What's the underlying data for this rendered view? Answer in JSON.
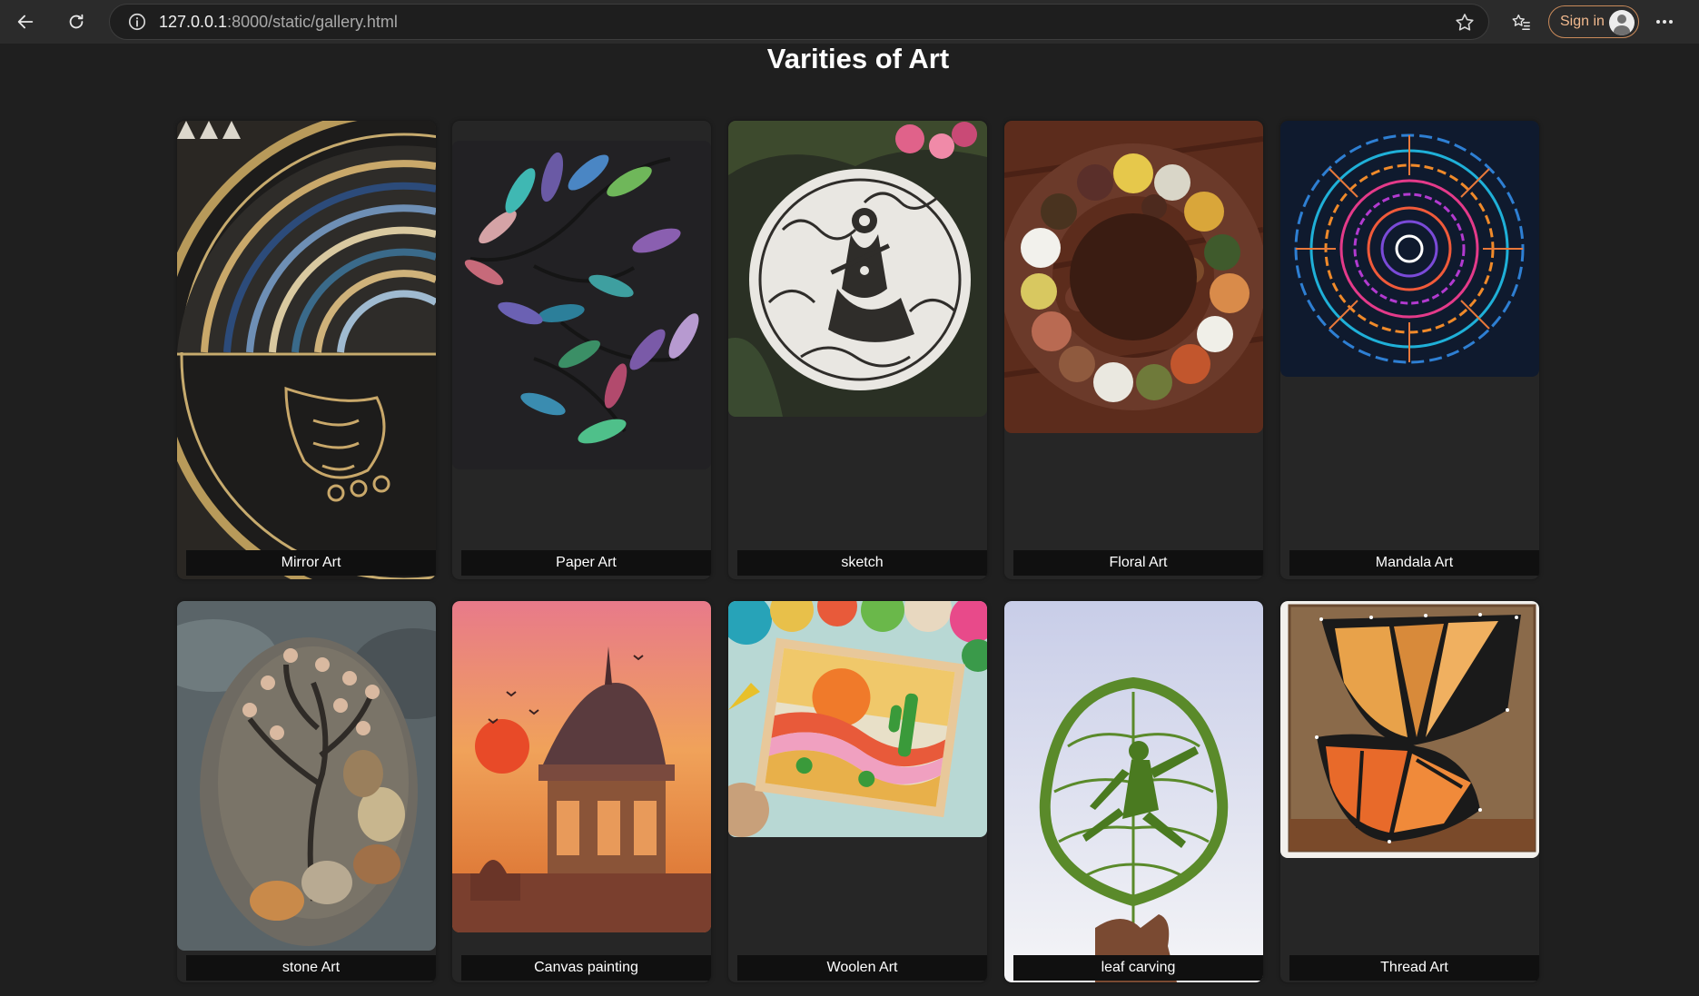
{
  "browser": {
    "url_host": "127.0.0.1",
    "url_path": ":8000/static/gallery.html",
    "signin_label": "Sign in"
  },
  "page": {
    "title": "Varities of Art"
  },
  "gallery": [
    {
      "label": "Mirror Art"
    },
    {
      "label": "Paper Art"
    },
    {
      "label": "sketch"
    },
    {
      "label": "Floral Art"
    },
    {
      "label": "Mandala Art"
    },
    {
      "label": "stone Art"
    },
    {
      "label": "Canvas painting"
    },
    {
      "label": "Woolen Art"
    },
    {
      "label": "leaf carving"
    },
    {
      "label": "Thread Art"
    }
  ]
}
